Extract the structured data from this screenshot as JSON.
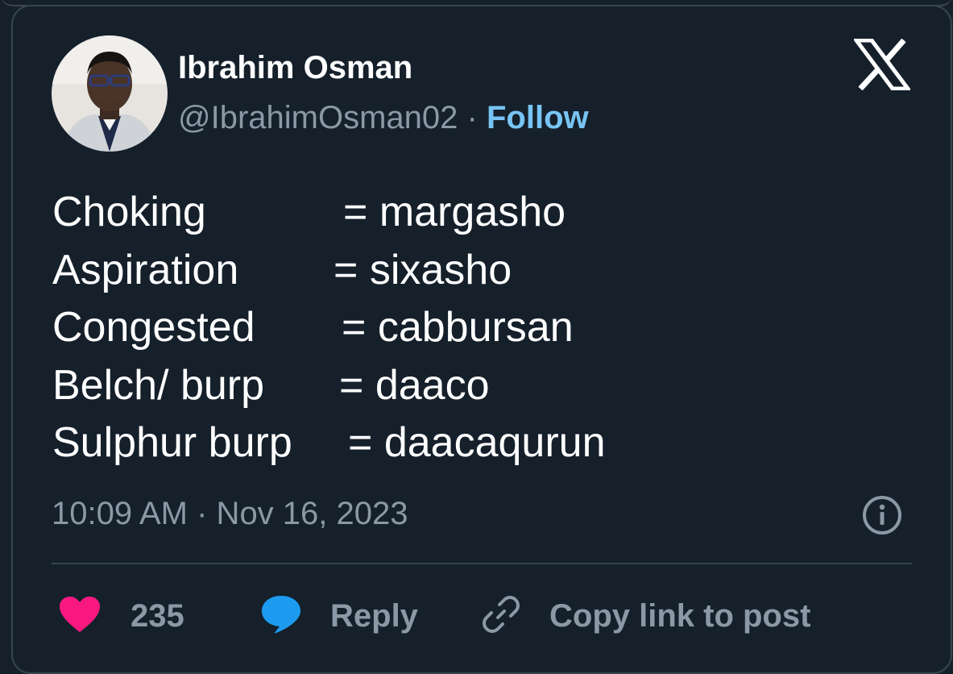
{
  "tweet": {
    "author": {
      "name": "Ibrahim Osman",
      "handle": "@IbrahimOsman02",
      "separator": "·",
      "follow_label": "Follow"
    },
    "lines": [
      {
        "term": "Choking",
        "def": "= margasho"
      },
      {
        "term": "Aspiration",
        "def": "= sixasho"
      },
      {
        "term": "Congested",
        "def": "= cabbursan"
      },
      {
        "term": "Belch/ burp",
        "def": "= daaco"
      },
      {
        "term": "Sulphur burp",
        "def": "= daacaqurun"
      }
    ],
    "timestamp": "10:09 AM · Nov 16, 2023"
  },
  "actions": {
    "like_count": "235",
    "reply_label": "Reply",
    "copy_link_label": "Copy link to post"
  },
  "icons": {
    "brand": "x-logo-icon",
    "info": "info-icon",
    "like": "heart-icon",
    "reply": "speech-bubble-icon",
    "copy_link": "link-icon"
  },
  "colors": {
    "background": "#15202b",
    "text": "#ffffff",
    "muted": "#8b98a5",
    "follow": "#78c4f4",
    "heart": "#f91880",
    "reply": "#1d9bf0"
  }
}
